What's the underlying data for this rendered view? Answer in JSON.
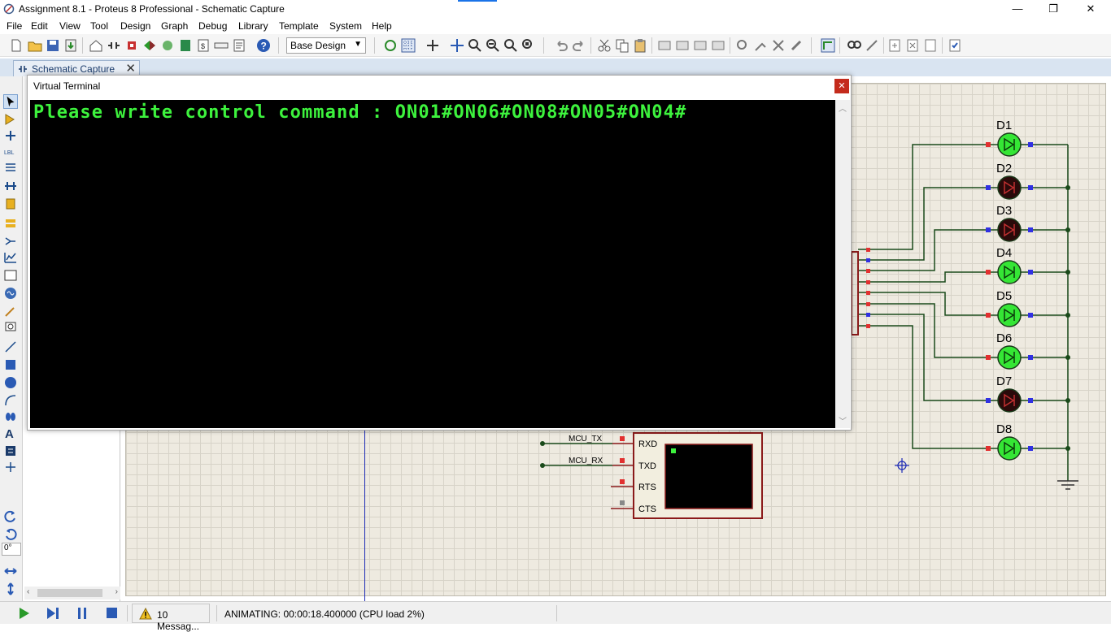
{
  "window": {
    "title": "Assignment 8.1 - Proteus 8 Professional - Schematic Capture",
    "minimize_glyph": "—",
    "maximize_glyph": "❐",
    "close_glyph": "✕"
  },
  "menu": [
    "File",
    "Edit",
    "View",
    "Tool",
    "Design",
    "Graph",
    "Debug",
    "Library",
    "Template",
    "System",
    "Help"
  ],
  "toolbar": {
    "design_select": "Base Design"
  },
  "tabs": [
    {
      "label": "Schematic Capture",
      "close": "✕"
    }
  ],
  "left_panel": {
    "rotation": "0°"
  },
  "virtual_terminal": {
    "title": "Virtual Terminal",
    "close": "✕",
    "text": "Please write control command : ON01#ON06#ON08#ON05#ON04#"
  },
  "schematic": {
    "leds": [
      {
        "label": "D1",
        "state": "on"
      },
      {
        "label": "D2",
        "state": "off"
      },
      {
        "label": "D3",
        "state": "off"
      },
      {
        "label": "D4",
        "state": "on"
      },
      {
        "label": "D5",
        "state": "on"
      },
      {
        "label": "D6",
        "state": "on"
      },
      {
        "label": "D7",
        "state": "off"
      },
      {
        "label": "D8",
        "state": "on"
      }
    ],
    "terminal_pins": [
      "RXD",
      "TXD",
      "RTS",
      "CTS"
    ],
    "net_labels": [
      "MCU_TX",
      "MCU_RX"
    ],
    "colors": {
      "led_on": "#35e635",
      "led_off": "#2a0a0a",
      "wire": "#1a4a1a",
      "component_border": "#8b1a1a",
      "sheet": "#eeeae0"
    }
  },
  "status": {
    "messages": "10 Messag...",
    "animation": "ANIMATING: 00:00:18.400000 (CPU load 2%)"
  }
}
